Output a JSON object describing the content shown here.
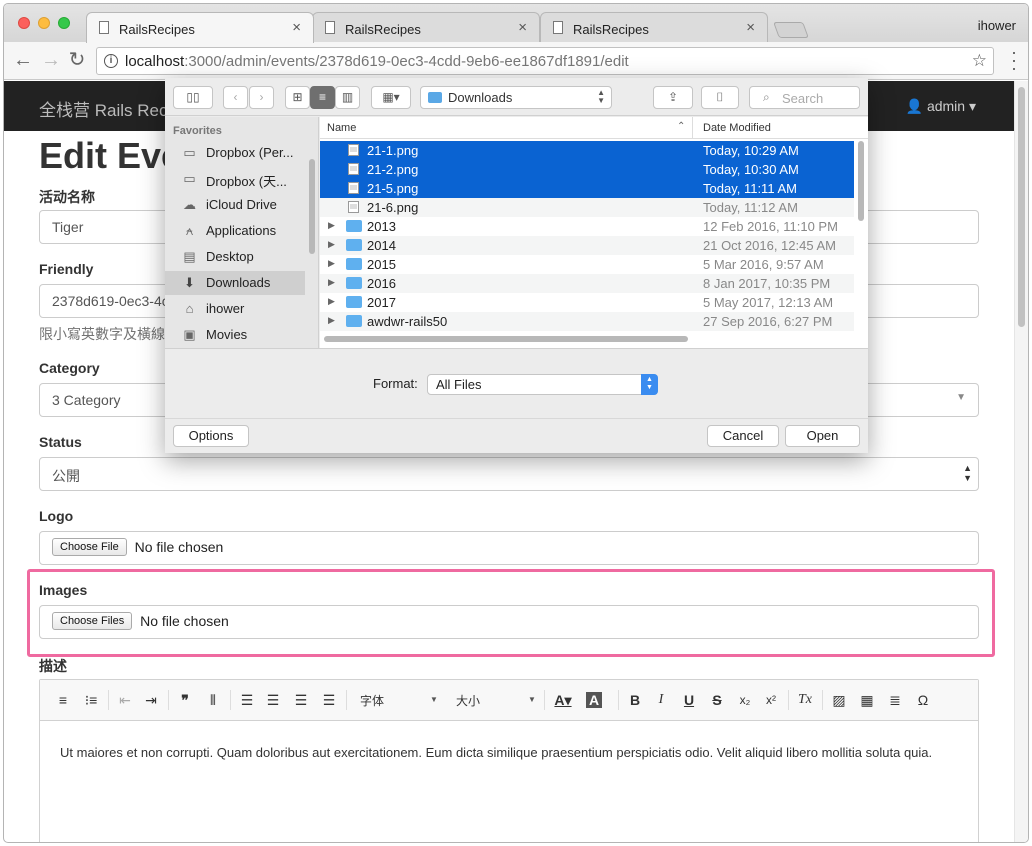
{
  "browser": {
    "tabs": [
      {
        "title": "RailsRecipes",
        "close": "×"
      },
      {
        "title": "RailsRecipes",
        "close": "×"
      },
      {
        "title": "RailsRecipes",
        "close": "×"
      }
    ],
    "profile": "ihower",
    "url_host": "localhost",
    "url_path": ":3000/admin/events/2378d619-0ec3-4cdd-9eb6-ee1867df1891/edit"
  },
  "navbar": {
    "brand": "全栈营 Rails Recipes",
    "user": "admin ▾"
  },
  "form": {
    "title": "Edit Event",
    "name_label": "活动名称",
    "name_value": "Tiger",
    "friendly_label": "Friendly",
    "friendly_value": "2378d619-0ec3-4cdd-9eb6-ee1867df1891",
    "friendly_help": "限小寫英數字及橫線",
    "category_label": "Category",
    "category_value": "3 Category",
    "status_label": "Status",
    "status_value": "公開",
    "logo_label": "Logo",
    "logo_button": "Choose File",
    "logo_status": "No file chosen",
    "images_label": "Images",
    "images_button": "Choose Files",
    "images_status": "No file chosen",
    "description_label": "描述",
    "description_text": "Ut maiores et non corrupti. Quam doloribus aut exercitationem. Eum dicta similique praesentium perspiciatis odio. Velit aliquid libero mollitia soluta quia."
  },
  "editor_toolbar": {
    "font_label": "字体",
    "size_label": "大小",
    "bold": "B",
    "italic": "I",
    "underline": "U",
    "strike": "S",
    "subscript": "x₂",
    "superscript": "x²",
    "clear_format": "Tx",
    "omega": "Ω"
  },
  "dialog": {
    "location": "Downloads",
    "search_placeholder": "Search",
    "sidebar_section": "Favorites",
    "sidebar_items": [
      {
        "label": "Dropbox (Per...",
        "icon": "folder-icon"
      },
      {
        "label": "Dropbox (天...",
        "icon": "folder-icon"
      },
      {
        "label": "iCloud Drive",
        "icon": "cloud-icon"
      },
      {
        "label": "Applications",
        "icon": "applications-icon"
      },
      {
        "label": "Desktop",
        "icon": "desktop-icon"
      },
      {
        "label": "Downloads",
        "icon": "downloads-icon",
        "selected": true
      },
      {
        "label": "ihower",
        "icon": "home-icon"
      },
      {
        "label": "Movies",
        "icon": "movies-icon"
      }
    ],
    "columns": {
      "name": "Name",
      "date": "Date Modified"
    },
    "files": [
      {
        "name": "21-1.png",
        "date": "Today, 10:29 AM",
        "kind": "file",
        "selected": true
      },
      {
        "name": "21-2.png",
        "date": "Today, 10:30 AM",
        "kind": "file",
        "selected": true
      },
      {
        "name": "21-5.png",
        "date": "Today, 11:11 AM",
        "kind": "file",
        "selected": true
      },
      {
        "name": "21-6.png",
        "date": "Today, 11:12 AM",
        "kind": "file",
        "selected": false
      },
      {
        "name": "2013",
        "date": "12 Feb 2016, 11:10 PM",
        "kind": "folder",
        "selected": false
      },
      {
        "name": "2014",
        "date": "21 Oct 2016, 12:45 AM",
        "kind": "folder",
        "selected": false
      },
      {
        "name": "2015",
        "date": "5 Mar 2016, 9:57 AM",
        "kind": "folder",
        "selected": false
      },
      {
        "name": "2016",
        "date": "8 Jan 2017, 10:35 PM",
        "kind": "folder",
        "selected": false
      },
      {
        "name": "2017",
        "date": "5 May 2017, 12:13 AM",
        "kind": "folder",
        "selected": false
      },
      {
        "name": "awdwr-rails50",
        "date": "27 Sep 2016, 6:27 PM",
        "kind": "folder",
        "selected": false
      }
    ],
    "format_label": "Format:",
    "format_value": "All Files",
    "options_button": "Options",
    "cancel_button": "Cancel",
    "open_button": "Open"
  },
  "colors": {
    "selection": "#0a63d2",
    "highlight_box": "#ef6aa0",
    "navbar": "#222222"
  }
}
